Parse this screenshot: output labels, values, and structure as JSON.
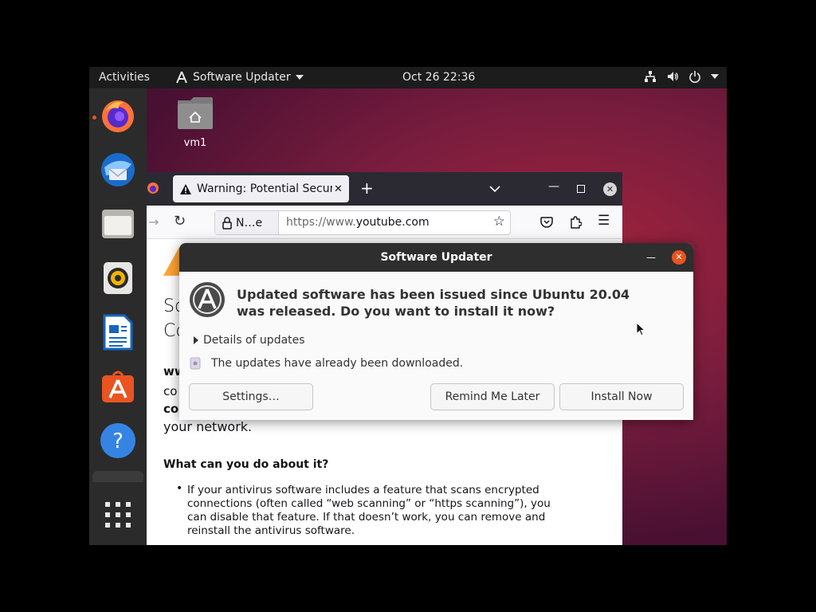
{
  "topbar": {
    "activities": "Activities",
    "app_name": "Software Updater",
    "clock": "Oct 26  22:36"
  },
  "desktop": {
    "home_label": "vm1"
  },
  "browser": {
    "tab_title": "Warning: Potential Securi",
    "identity_label": "N…e",
    "url_prefix": "https://www.",
    "url_domain": "youtube.com",
    "page": {
      "heading_partial_1": "So",
      "heading_partial_2": "Co",
      "strong_partial_1": "ww",
      "text_partial_1": "co",
      "strong_partial_2": "co",
      "network_text": "your network.",
      "what_heading": "What can you do about it?",
      "bullet": "If your antivirus software includes a feature that scans encrypted connections (often called “web scanning” or “https scanning”), you can disable that feature. If that doesn’t work, you can remove and reinstall the antivirus software."
    }
  },
  "dialog": {
    "title": "Software Updater",
    "message": "Updated software has been issued since Ubuntu 20.04 was released. Do you want to install it now?",
    "details": "Details of updates",
    "downloaded": "The updates have already been downloaded.",
    "settings_btn": "Settings…",
    "remind_btn": "Remind Me Later",
    "install_btn": "Install Now"
  },
  "colors": {
    "ubuntu_orange": "#e95420",
    "topbar": "#1c1c1c",
    "dock": "#2b2b2b"
  }
}
